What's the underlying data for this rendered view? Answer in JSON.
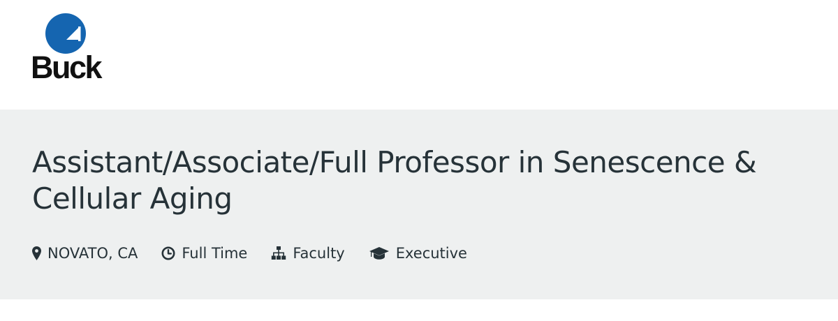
{
  "header": {
    "logo_text": "Buck",
    "logo_color": "#1565b0"
  },
  "job": {
    "title": "Assistant/Associate/Full Professor in Senescence & Cellular Aging",
    "meta": [
      {
        "icon": "map-marker-icon",
        "label": "NOVATO, CA"
      },
      {
        "icon": "clock-icon",
        "label": "Full Time"
      },
      {
        "icon": "sitemap-icon",
        "label": "Faculty"
      },
      {
        "icon": "graduation-cap-icon",
        "label": "Executive"
      }
    ]
  },
  "colors": {
    "banner_background": "#eef0f0",
    "text": "#263238"
  }
}
